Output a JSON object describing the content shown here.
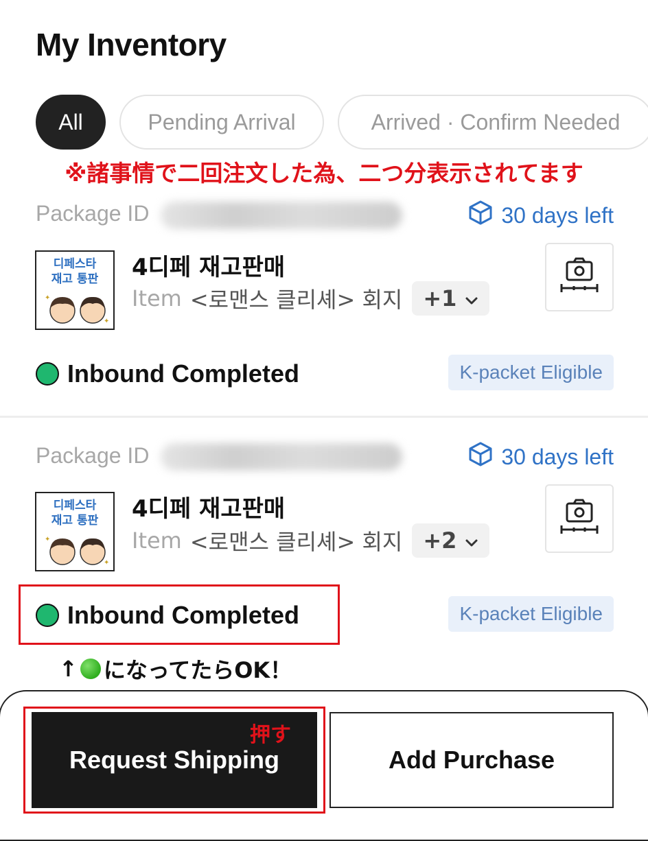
{
  "header": {
    "title": "My Inventory"
  },
  "tabs": [
    {
      "label": "All",
      "active": true
    },
    {
      "label": "Pending Arrival",
      "active": false
    },
    {
      "label": "Arrived · Confirm Needed",
      "active": false
    }
  ],
  "note": "※諸事情で二回注文した為、二つ分表示されてます",
  "packages": [
    {
      "id_label": "Package ID",
      "days_left": "30 days left",
      "thumb_line1": "디페스타",
      "thumb_line2": "재고 통판",
      "title": "4디페 재고판매",
      "item_label": "Item",
      "item_name": "<로맨스 클리셰> 회지",
      "extra_count": "+1",
      "status": "Inbound Completed",
      "badge": "K-packet Eligible"
    },
    {
      "id_label": "Package ID",
      "days_left": "30 days left",
      "thumb_line1": "디페스타",
      "thumb_line2": "재고 통판",
      "title": "4디페 재고판매",
      "item_label": "Item",
      "item_name": "<로맨스 클리셰> 회지",
      "extra_count": "+2",
      "status": "Inbound Completed",
      "badge": "K-packet Eligible"
    }
  ],
  "annotation": {
    "arrow": "↑",
    "text": "になってたらOK！"
  },
  "push_note": "押す",
  "actions": {
    "request_shipping": "Request Shipping",
    "add_purchase": "Add Purchase"
  },
  "colors": {
    "accent_blue": "#2f72c6",
    "status_green": "#1fb76f",
    "annotation_red": "#e0121a",
    "dark_button": "#191919"
  },
  "icons": {
    "days_left": "cube-icon",
    "photo_measure": "camera-measure-icon",
    "dropdown": "chevron-down-icon",
    "status": "status-dot-icon"
  }
}
